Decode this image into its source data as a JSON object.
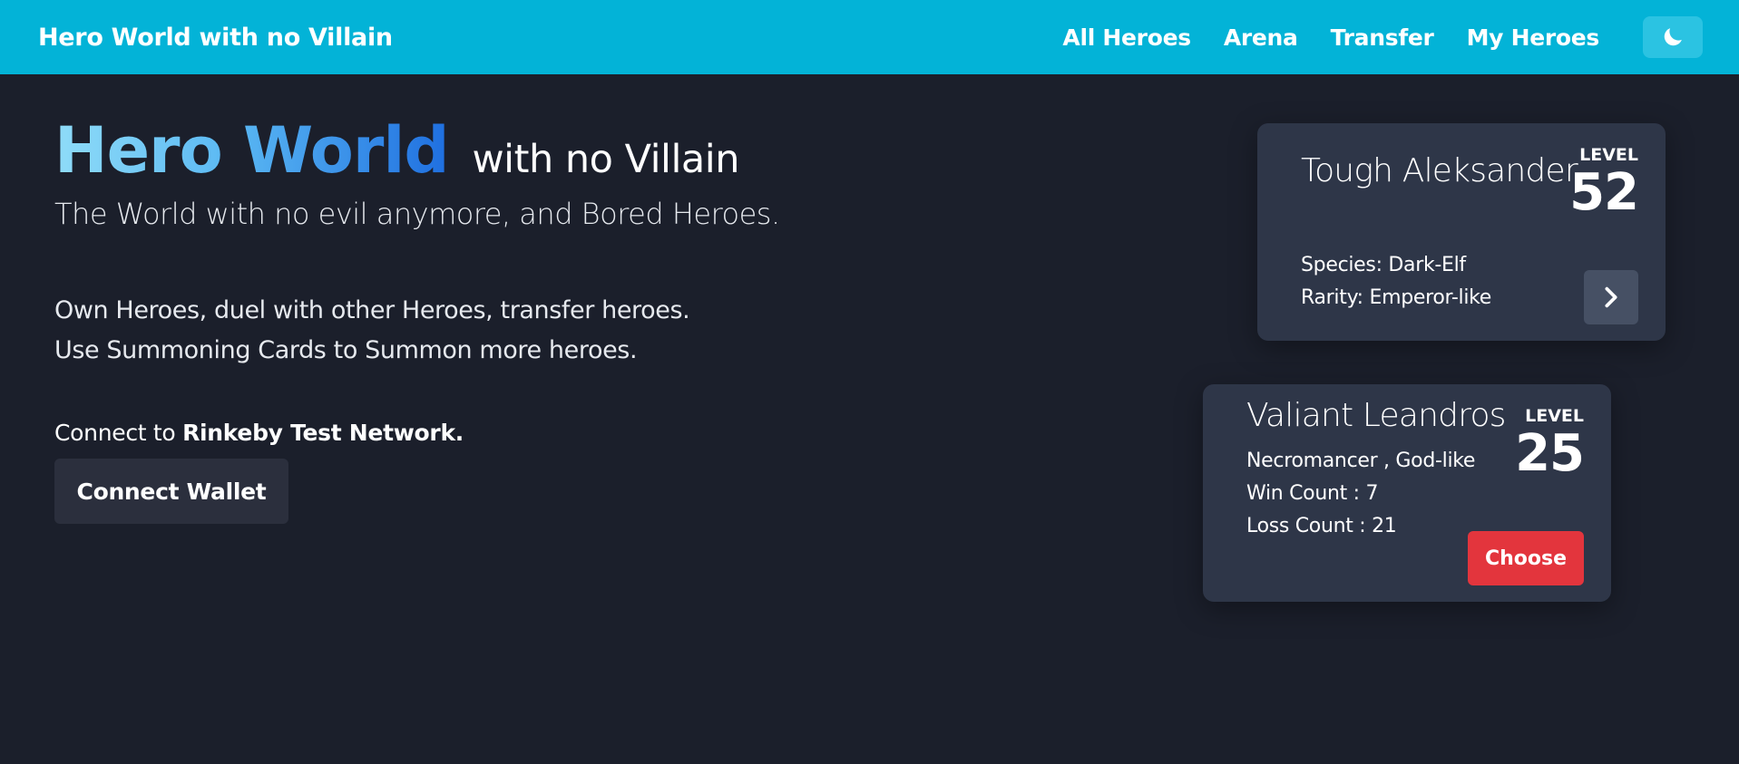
{
  "navbar": {
    "brand": "Hero World with no Villain",
    "links": [
      "All Heroes",
      "Arena",
      "Transfer",
      "My Heroes"
    ],
    "theme_toggle_icon": "moon-icon"
  },
  "hero": {
    "title_big": "Hero World",
    "title_small": "with no Villain",
    "tagline": "The World with no evil anymore, and Bored Heroes.",
    "desc_line1": "Own Heroes, duel with other Heroes, transfer heroes.",
    "desc_line2": "Use Summoning Cards to Summon more heroes.",
    "connect_prefix": "Connect to ",
    "connect_network": "Rinkeby Test Network.",
    "connect_button": "Connect Wallet"
  },
  "card1": {
    "name": "Tough Aleksander",
    "level_label": "LEVEL",
    "level": "52",
    "species": "Species: Dark-Elf",
    "rarity": "Rarity: Emperor-like",
    "action_icon": "chevron-right-icon"
  },
  "card2": {
    "name": "Valiant Leandros",
    "level_label": "LEVEL",
    "level": "25",
    "type": "Necromancer , God-like",
    "wins": "Win Count : 7",
    "losses": "Loss Count : 21",
    "choose_button": "Choose"
  },
  "colors": {
    "navbar": "#03b3d7",
    "background": "#1b1f2b",
    "card": "#2e3648",
    "choose": "#e3353d"
  }
}
